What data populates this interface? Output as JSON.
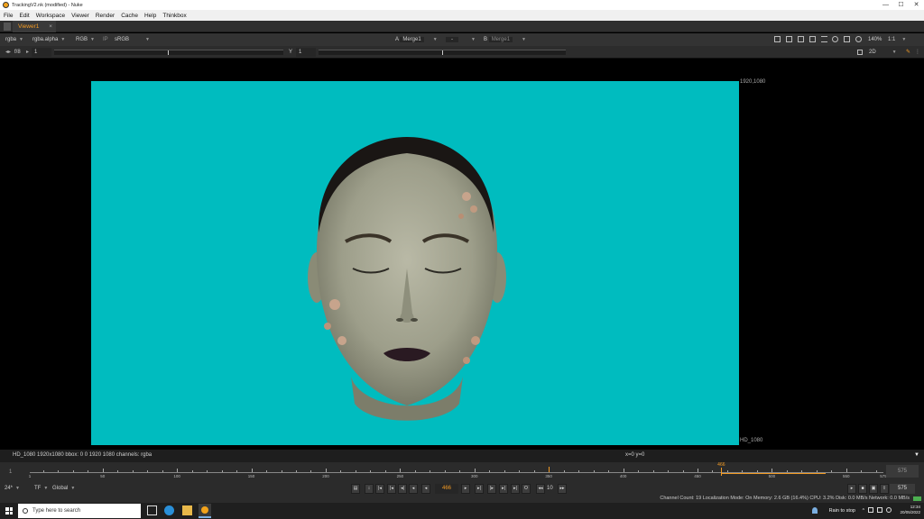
{
  "window": {
    "title": "TrackingV2.nk (modified) - Nuke",
    "controls": {
      "minimize": "—",
      "maximize": "☐",
      "close": "✕"
    }
  },
  "menu": [
    "File",
    "Edit",
    "Workspace",
    "Viewer",
    "Render",
    "Cache",
    "Help",
    "Thinkbox"
  ],
  "tab": {
    "label": "Viewer1",
    "close": "×"
  },
  "viewer_toolbar": {
    "channels": "rgba",
    "alpha": "rgba.alpha",
    "display": "RGB",
    "ip": "IP",
    "lut": "sRGB",
    "a_label": "A",
    "a_input": "Merge1",
    "mode": "-",
    "b_label": "B",
    "b_input": "Merge1",
    "zoom": "140%",
    "ratio": "1:1"
  },
  "viewer_toolbar2": {
    "fstop": "f/8",
    "gain": "1",
    "y_label": "Y",
    "gamma": "1",
    "view_mode": "2D"
  },
  "viewer": {
    "format_top_right": "1920,1080",
    "format_bottom_right": "HD_1080",
    "background_color": "#00bcbf"
  },
  "info_bar": {
    "left": "HD_1080 1920x1080  bbox: 0 0 1920 1080 channels: rgba",
    "coords": "x=0 y=0",
    "menu": "▼"
  },
  "timeline": {
    "start": "1",
    "end": "575",
    "current": "466",
    "ticks": [
      "1",
      "50",
      "100",
      "150",
      "200",
      "250",
      "300",
      "350",
      "400",
      "450",
      "500",
      "550",
      "575"
    ],
    "marker_a": "350"
  },
  "playback": {
    "fps": "24*",
    "tf": "TF",
    "global": "Global",
    "frame": "466",
    "increment": "10",
    "end_frame": "575"
  },
  "status": {
    "text": "Channel Count: 19  Localization Mode: On  Memory: 2.6 GB (16.4%)  CPU: 3.2%  Disk: 0.0 MB/s  Network: 0.0 MB/s"
  },
  "taskbar": {
    "search_placeholder": "Type here to search",
    "weather": "Rain to stop",
    "time": "12:34",
    "date": "20/05/2022"
  }
}
